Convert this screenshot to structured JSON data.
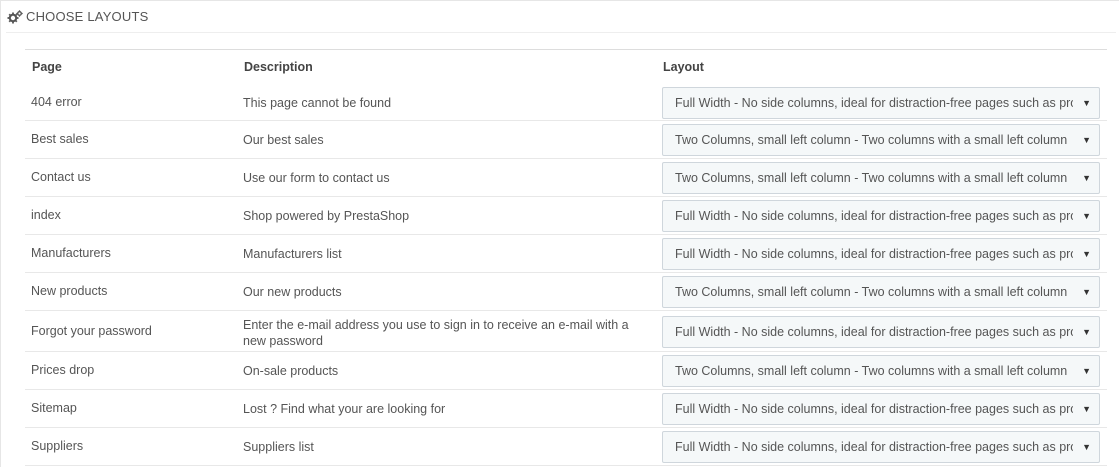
{
  "panel": {
    "title": "CHOOSE LAYOUTS",
    "icon": "gears-icon"
  },
  "table": {
    "columns": {
      "page": "Page",
      "description": "Description",
      "layout": "Layout"
    },
    "rows": [
      {
        "page": "404 error",
        "description": "This page cannot be found",
        "layout": "Full Width - No side columns, ideal for distraction-free pages such as product pages."
      },
      {
        "page": "Best sales",
        "description": "Our best sales",
        "layout": "Two Columns, small left column - Two columns with a small left column"
      },
      {
        "page": "Contact us",
        "description": "Use our form to contact us",
        "layout": "Two Columns, small left column - Two columns with a small left column"
      },
      {
        "page": "index",
        "description": "Shop powered by PrestaShop",
        "layout": "Full Width - No side columns, ideal for distraction-free pages such as product pages."
      },
      {
        "page": "Manufacturers",
        "description": "Manufacturers list",
        "layout": "Full Width - No side columns, ideal for distraction-free pages such as product pages."
      },
      {
        "page": "New products",
        "description": "Our new products",
        "layout": "Two Columns, small left column - Two columns with a small left column"
      },
      {
        "page": "Forgot your password",
        "description": "Enter the e-mail address you use to sign in to receive an e-mail with a new password",
        "layout": "Full Width - No side columns, ideal for distraction-free pages such as product pages."
      },
      {
        "page": "Prices drop",
        "description": "On-sale products",
        "layout": "Two Columns, small left column - Two columns with a small left column"
      },
      {
        "page": "Sitemap",
        "description": "Lost ? Find what your are looking for",
        "layout": "Full Width - No side columns, ideal for distraction-free pages such as product pages."
      },
      {
        "page": "Suppliers",
        "description": "Suppliers list",
        "layout": "Full Width - No side columns, ideal for distraction-free pages such as product pages."
      }
    ]
  }
}
